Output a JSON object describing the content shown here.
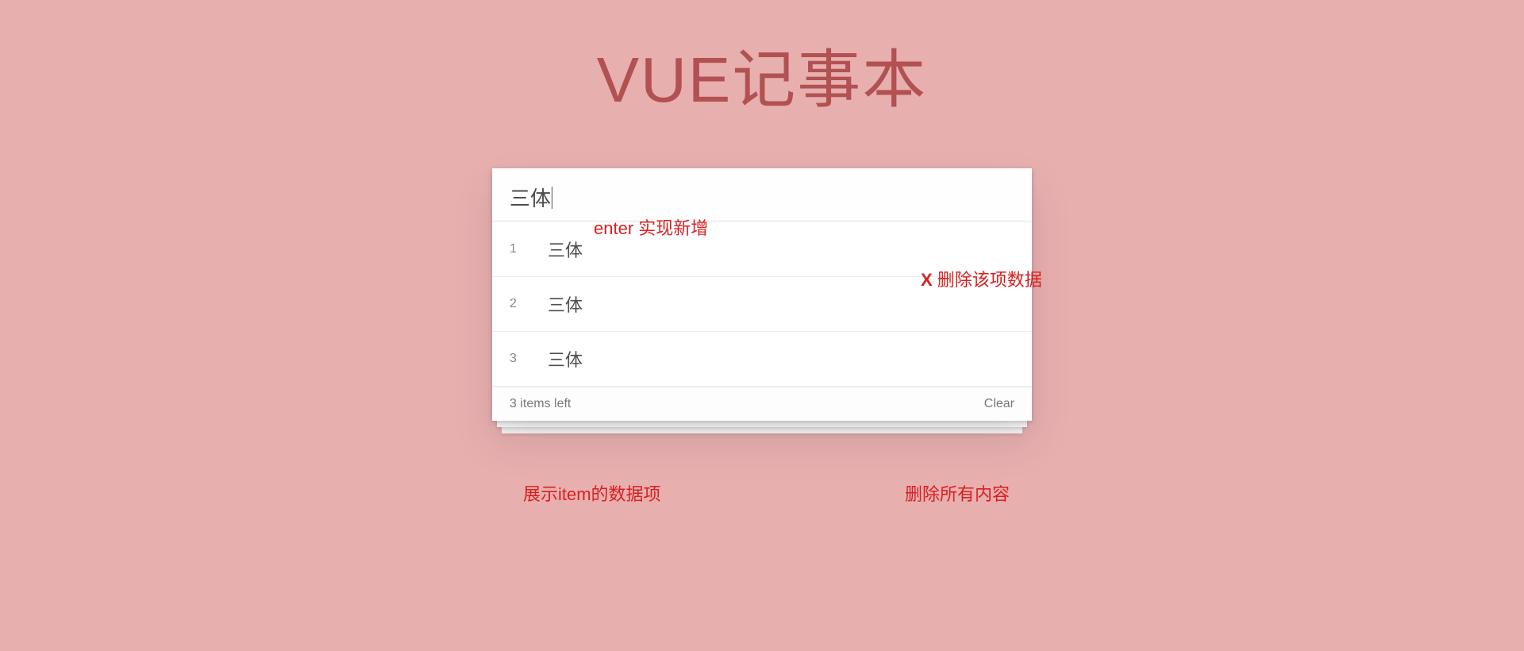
{
  "header": {
    "title": "VUE记事本"
  },
  "input": {
    "value": "三体",
    "placeholder": ""
  },
  "items": [
    {
      "index": "1",
      "text": "三体"
    },
    {
      "index": "2",
      "text": "三体"
    },
    {
      "index": "3",
      "text": "三体"
    }
  ],
  "footer": {
    "count_text": "3 items left",
    "clear_label": "Clear"
  },
  "annotations": {
    "enter_hint": "enter 实现新增",
    "delete_x": "X",
    "delete_hint": "删除该项数据",
    "show_hint": "展示item的数据项",
    "clear_hint": "删除所有内容"
  }
}
